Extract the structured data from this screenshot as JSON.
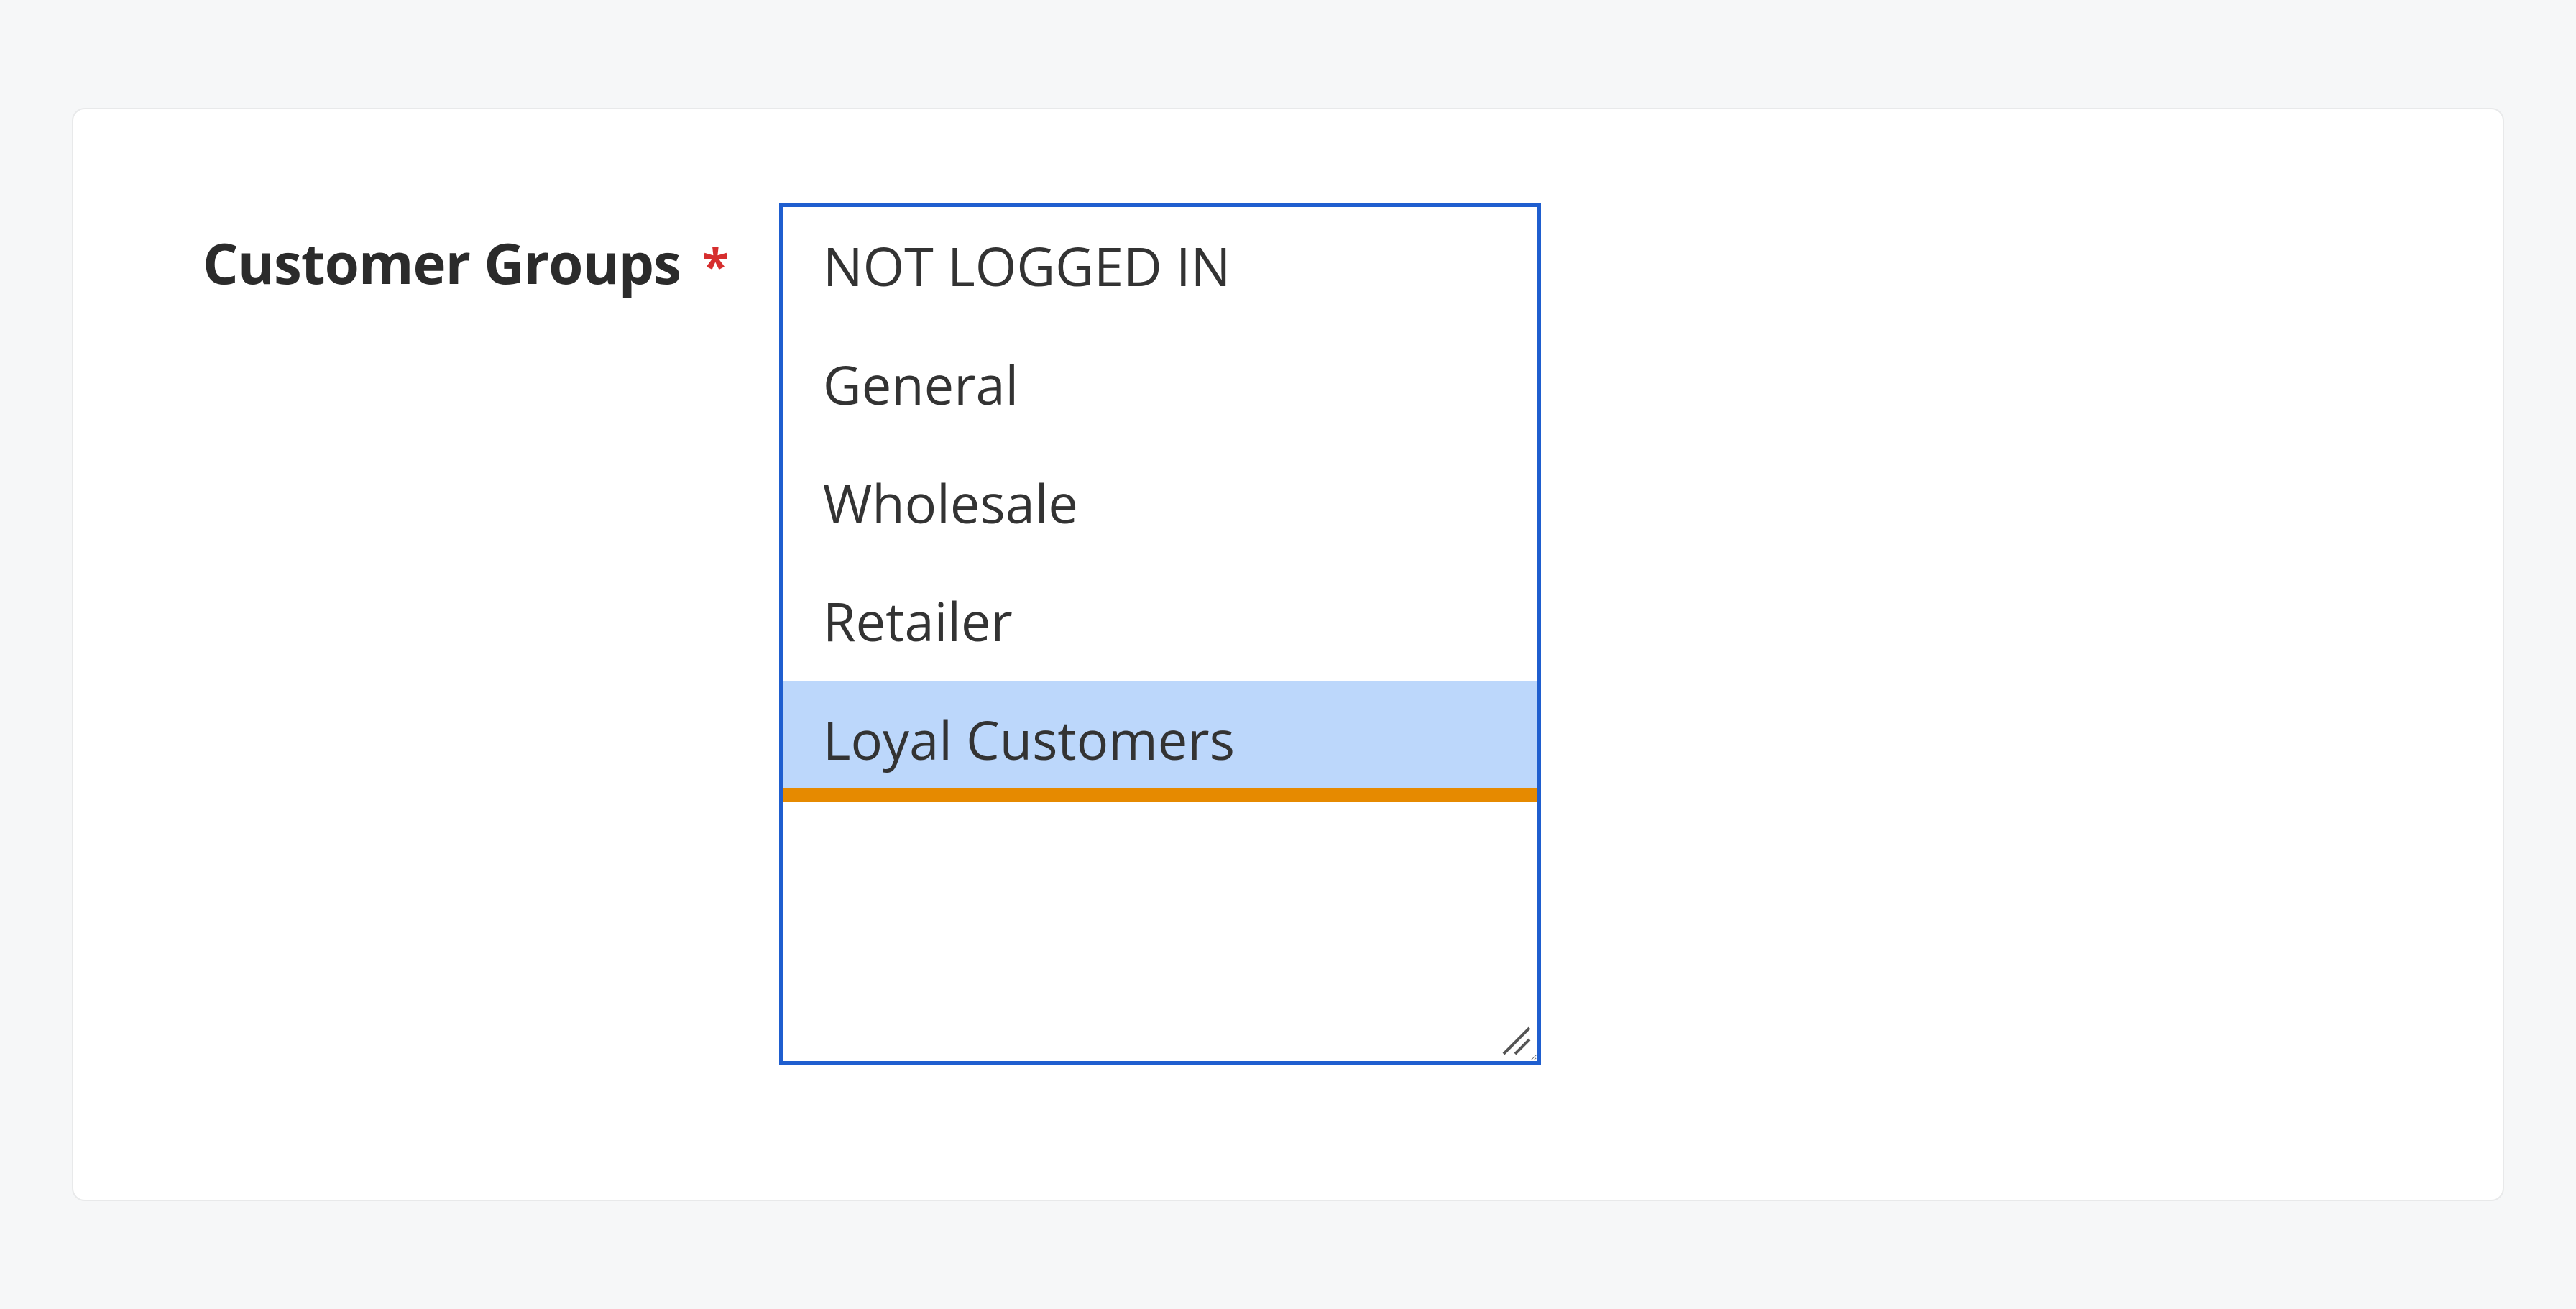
{
  "field": {
    "label": "Customer Groups",
    "required_mark": "*",
    "options": [
      {
        "label": "NOT LOGGED IN",
        "selected": false
      },
      {
        "label": "General",
        "selected": false
      },
      {
        "label": "Wholesale",
        "selected": false
      },
      {
        "label": "Retailer",
        "selected": false
      },
      {
        "label": "Loyal Customers",
        "selected": true
      }
    ],
    "colors": {
      "border_focus": "#1f5ecf",
      "selected_bg": "#bcd7fb",
      "underline": "#e68a00",
      "required": "#d62e2e"
    }
  }
}
